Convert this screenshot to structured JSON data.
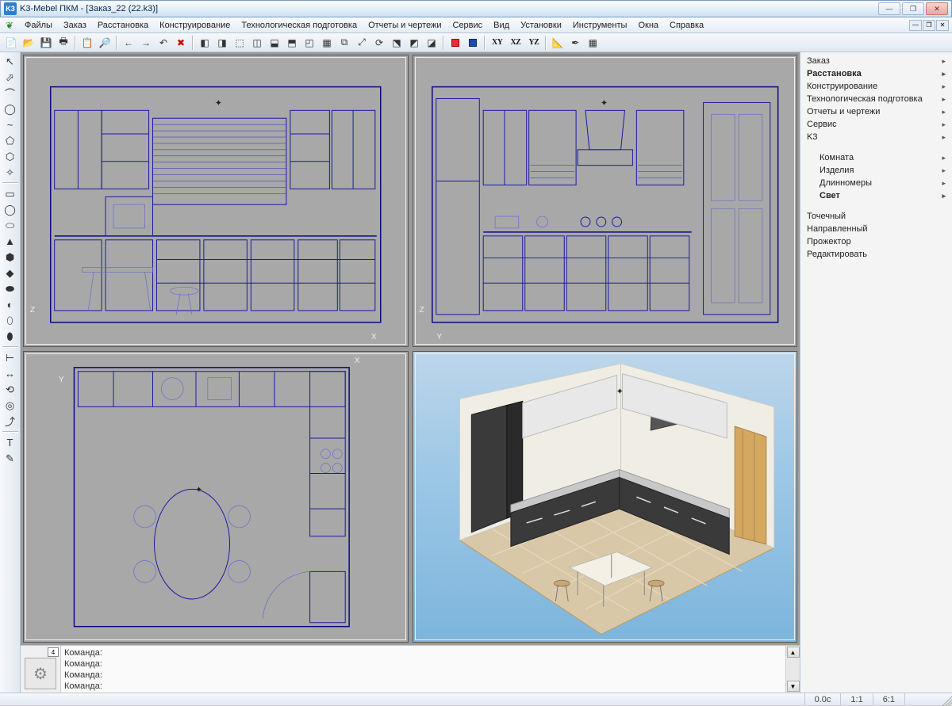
{
  "titlebar": {
    "app_icon_text": "K3",
    "title": "K3-Mebel ПКМ - [Заказ_22 (22.k3)]"
  },
  "window_buttons": {
    "min": "—",
    "max": "❐",
    "close": "✕"
  },
  "mdi_buttons": {
    "min": "—",
    "restore": "❐",
    "close": "✕"
  },
  "menubar": {
    "items": [
      "Файлы",
      "Заказ",
      "Расстановка",
      "Конструирование",
      "Технологическая подготовка",
      "Отчеты и чертежи",
      "Сервис",
      "Вид",
      "Установки",
      "Инструменты",
      "Окна",
      "Справка"
    ]
  },
  "toolbar_top": {
    "icons": [
      "📄",
      "📂",
      "💾",
      "🖶"
    ],
    "icons2": [
      "📋",
      "🔎"
    ],
    "icons3": [
      "←",
      "→",
      "↶",
      "✖"
    ],
    "icons4": [
      "◧",
      "◨",
      "⬚",
      "◫",
      "⬓",
      "⬒",
      "◰",
      "▦",
      "⧉",
      "⤢",
      "⟳",
      "⬔",
      "◩",
      "◪"
    ],
    "colors": [
      "red",
      "blue"
    ],
    "axis_btns": [
      "XY",
      "XZ",
      "YZ"
    ],
    "icons5": [
      "📐",
      "✒",
      "▦"
    ]
  },
  "left_tools": {
    "group1": [
      "↖",
      "⬀",
      "⌒",
      "◯",
      "~",
      "⬠",
      "⬡",
      "✧"
    ],
    "group2": [
      "▭",
      "◯",
      "⬭",
      "▲",
      "⬢",
      "◆",
      "⬬",
      "◐",
      "⬯",
      "⬮"
    ],
    "group3": [
      "⊢",
      "↔",
      "⟲",
      "◎",
      "⤴"
    ],
    "group4": [
      "T",
      "✎"
    ]
  },
  "sidepanel": {
    "top": [
      {
        "label": "Заказ",
        "bold": false
      },
      {
        "label": "Расстановка",
        "bold": true
      },
      {
        "label": "Конструирование",
        "bold": false
      },
      {
        "label": "Технологическая подготовка",
        "bold": false
      },
      {
        "label": "Отчеты и чертежи",
        "bold": false
      },
      {
        "label": "Сервис",
        "bold": false
      },
      {
        "label": "K3",
        "bold": false
      }
    ],
    "mid": [
      {
        "label": "Комната",
        "bold": false
      },
      {
        "label": "Изделия",
        "bold": false
      },
      {
        "label": "Длинномеры",
        "bold": false
      },
      {
        "label": "Свет",
        "bold": true
      }
    ],
    "bottom": [
      {
        "label": "Точечный"
      },
      {
        "label": "Направленный"
      },
      {
        "label": "Прожектор"
      },
      {
        "label": "Редактировать"
      }
    ]
  },
  "command_area": {
    "badge": "4",
    "lines": [
      "Команда:",
      "Команда:",
      "Команда:",
      "Команда:"
    ]
  },
  "statusbar": {
    "time": "0.0c",
    "ratio1": "1:1",
    "ratio2": "6:1"
  },
  "viewports": {
    "front_axis_x": "X",
    "front_axis_z": "Z",
    "side_axis_y": "Y",
    "side_axis_z": "Z",
    "top_axis_x": "X",
    "top_axis_y": "Y"
  }
}
